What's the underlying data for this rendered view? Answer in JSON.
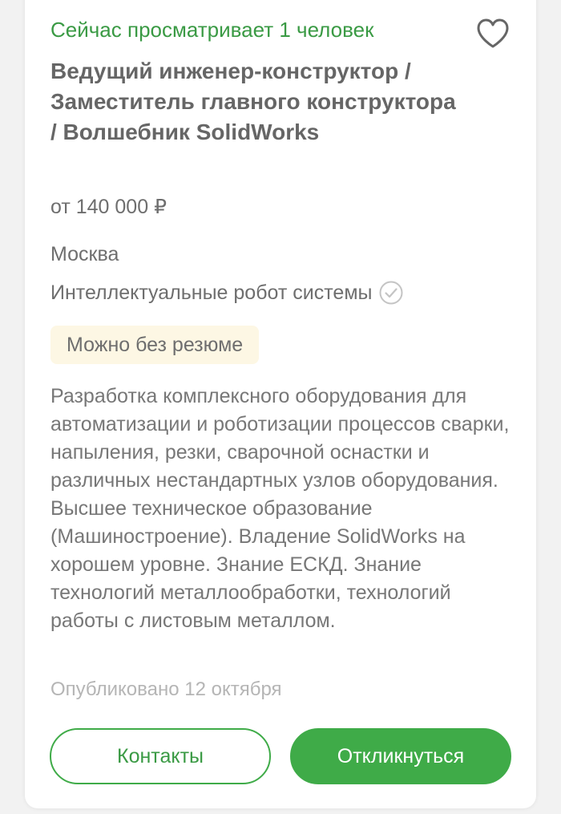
{
  "vacancy": {
    "viewing_now": "Сейчас просматривает 1 человек",
    "title": "Ведущий инженер-конструктор / Заместитель главного конструктора / Волшебник SolidWorks",
    "salary": "от 140 000 ₽",
    "city": "Москва",
    "company": "Интеллектуальные робот системы",
    "badge": "Можно без резюме",
    "description": "Разработка комплексного оборудования для автоматизации и роботизации процессов сварки, напыления, резки, сварочной оснастки и различных нестандартных узлов оборудования. Высшее техническое образование (Машиностроение). Владение SolidWorks на хорошем уровне. Знание ЕСКД. Знание технологий металлообработки, технологий работы с листовым металлом.",
    "published": "Опубликовано 12 октября"
  },
  "actions": {
    "contacts_label": "Контакты",
    "apply_label": "Откликнуться"
  },
  "icons": {
    "favorite": "heart-outline-icon",
    "verified": "check-circle-icon"
  },
  "colors": {
    "accent_green": "#3fab48",
    "viewing_text": "#3a9a44",
    "badge_bg": "#fdf7e4",
    "muted_text": "#b5b5b5"
  }
}
